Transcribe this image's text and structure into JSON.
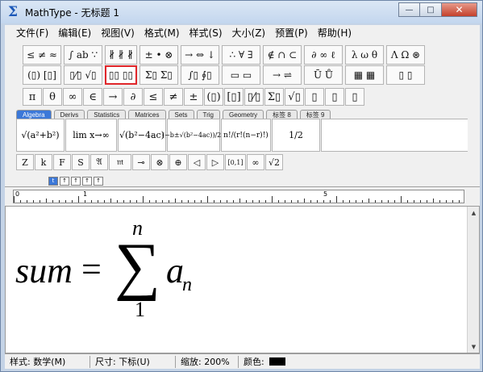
{
  "window": {
    "title": "MathType - 无标题 1",
    "controls": {
      "minimize": "—",
      "maximize": "□",
      "close": "✕"
    }
  },
  "menu": [
    "文件(F)",
    "编辑(E)",
    "视图(V)",
    "格式(M)",
    "样式(S)",
    "大小(Z)",
    "预置(P)",
    "帮助(H)"
  ],
  "toolbar": {
    "palette_row1": [
      "≤ ≠ ≈",
      "∫ ab ∵",
      "∦ ∦ ∦",
      "± • ⊗",
      "→ ⇔ ↓",
      "∴ ∀ ∃",
      "∉ ∩ ⊂",
      "∂ ∞ ℓ",
      "λ ω θ",
      "Λ Ω ⊛"
    ],
    "palette_row2": [
      "(▯) [▯]",
      "▯⁄▯ √▯",
      "▯▯ ▯▯",
      "Σ▯ Σ▯",
      "∫▯ ∮▯",
      "▭ ▭",
      "→ ⇌",
      "Ū Ů",
      "▦ ▦",
      "▯ ▯"
    ],
    "selected_palette": "▯▯ ▯▯",
    "symbols_row": [
      "π",
      "θ",
      "∞",
      "∈",
      "→",
      "∂",
      "≤",
      "≠",
      "±",
      "(▯)",
      "[▯]",
      "▯⁄▯",
      "Σ▯",
      "√▯",
      "▯",
      "▯",
      "▯"
    ],
    "tabs": [
      "Algebra",
      "Derivs",
      "Statistics",
      "Matrices",
      "Sets",
      "Trig",
      "Geometry",
      "标签 8",
      "标签 9"
    ],
    "active_tab": "Algebra",
    "templates": [
      "√(a²+b²)",
      "lim x→∞",
      "√(b²−4ac)",
      "(−b±√(b²−4ac))/2a",
      "n!/(r!(n−r)!)",
      "1/2"
    ],
    "small_row": [
      "Z",
      "k",
      "F",
      "S",
      "𝔄",
      "𝔪",
      "⊸",
      "⊗",
      "⊕",
      "◁",
      "▷",
      "[0,1]",
      "∞",
      "√2"
    ],
    "format_buttons": [
      "t",
      "↑",
      "↑",
      "↑",
      "↑"
    ]
  },
  "ruler": {
    "labels": [
      "0",
      "1",
      "5"
    ]
  },
  "equation": {
    "lhs": "sum",
    "equals": "=",
    "operator": "∑",
    "upper": "n",
    "lower": "1",
    "term": "a",
    "subscript": "n"
  },
  "status": {
    "style": "样式: 数学(M)",
    "size": "尺寸: 下标(U)",
    "zoom": "缩放: 200%",
    "color_label": "颜色:",
    "color": "#000000"
  }
}
